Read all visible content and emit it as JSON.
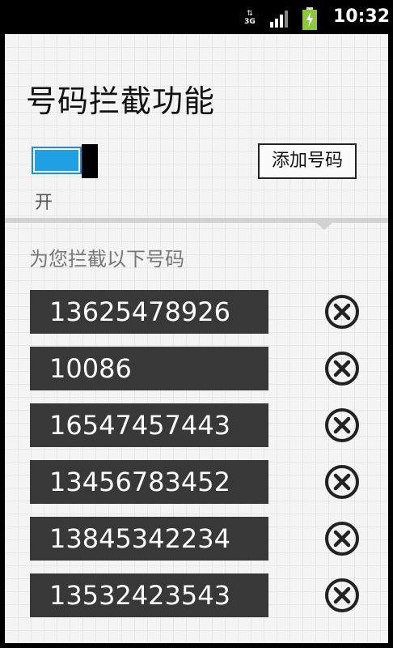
{
  "status_bar": {
    "network": "3G",
    "time": "10:32"
  },
  "header": {
    "title": "号码拦截功能"
  },
  "toggle": {
    "state": "on",
    "label": "开",
    "accent_color": "#22a0e4"
  },
  "actions": {
    "add_label": "添加号码"
  },
  "blocked": {
    "section_label": "为您拦截以下号码",
    "numbers": [
      "13625478926",
      "10086",
      "16547457443",
      "13456783452",
      "13845342234",
      "13532423543"
    ]
  },
  "icons": {
    "delete": "circle-x-icon",
    "signal": "signal-icon",
    "battery": "battery-charging-icon",
    "network": "3g-icon"
  }
}
